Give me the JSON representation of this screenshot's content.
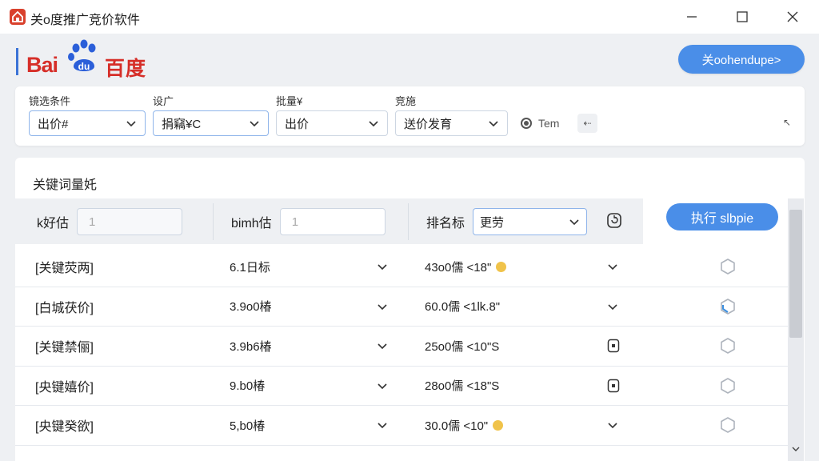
{
  "window": {
    "title": "关o度推广竞价软件"
  },
  "header": {
    "logo_text_latin": "Bai",
    "logo_text_paw": "du",
    "logo_text_cn": "百度",
    "action_button": "关oohendupe>"
  },
  "filters": {
    "groups": [
      {
        "label": "镜选条件",
        "value": "出价#"
      },
      {
        "label": "设广",
        "value": "捐竊¥C"
      },
      {
        "label": "批量¥",
        "value": "出价"
      },
      {
        "label": "竞施",
        "value": "送价发育"
      }
    ],
    "radio_label": "Tem",
    "small_button": "⇠",
    "corner_button": "↖"
  },
  "main": {
    "section_title": "关键词量奼",
    "toolbar": {
      "label1": "k好估",
      "input1": "1",
      "label2": "bimh估",
      "input2": "1",
      "label3": "排名标",
      "select3": "更劳"
    },
    "execute_button": "执行 slbpie"
  },
  "table": {
    "rows": [
      {
        "keyword": "[关键荧两]",
        "bid": "6.1日标",
        "rank": "43o0儒 <18\"",
        "rank_marker": "coin",
        "action": "chevron",
        "checked": false
      },
      {
        "keyword": "[白城茯价]",
        "bid": "3.9o0椿",
        "rank": "60.0儒 <1lk.8\"",
        "rank_marker": "none",
        "action": "chevron",
        "checked": true
      },
      {
        "keyword": "[关键禁俪]",
        "bid": "3.9b6椿",
        "rank": "25o0儒 <10\"S",
        "rank_marker": "none",
        "action": "doc",
        "checked": false
      },
      {
        "keyword": "[央键嬉价]",
        "bid": "9.b0椿",
        "rank": "28o0儒 <18\"S",
        "rank_marker": "none",
        "action": "doc",
        "checked": false
      },
      {
        "keyword": "[央键癸欲]",
        "bid": "5,b0椿",
        "rank": "30.0儒 <10\"",
        "rank_marker": "coin",
        "action": "chevron",
        "checked": false
      }
    ]
  },
  "colors": {
    "accent": "#4a8ee8",
    "brand_red": "#d62e28",
    "brand_blue": "#2b5fd9"
  }
}
